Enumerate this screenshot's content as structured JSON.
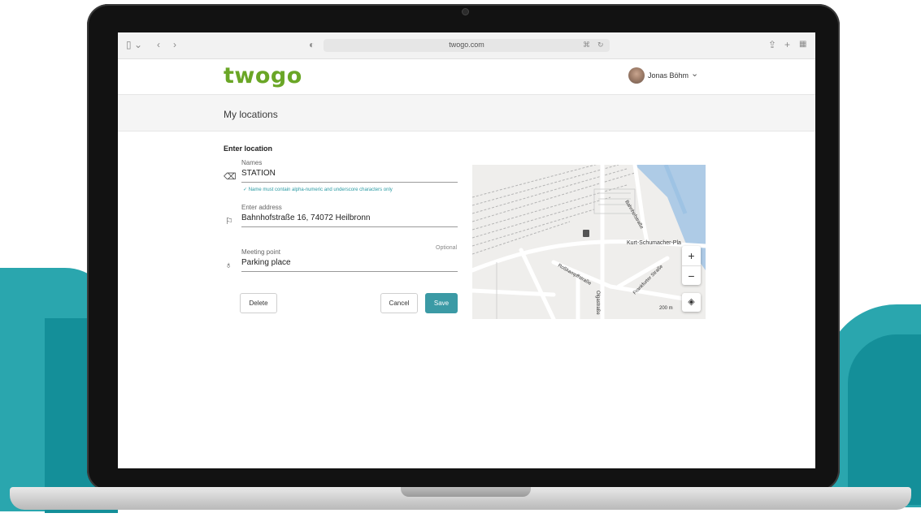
{
  "browser": {
    "url": "twogo.com"
  },
  "app": {
    "logo": "twogo",
    "user_name": "Jonas Böhm",
    "page_title": "My locations"
  },
  "form": {
    "section_title": "Enter location",
    "name": {
      "label": "Names",
      "value": "STATION",
      "hint": "Name must contain alpha-numeric and underscore characters only"
    },
    "address": {
      "label": "Enter address",
      "value": "Bahnhofstraße 16, 74072 Heilbronn"
    },
    "meeting_point": {
      "label": "Meeting point",
      "value": "Parking place",
      "optional_label": "Optional"
    },
    "buttons": {
      "delete": "Delete",
      "cancel": "Cancel",
      "save": "Save"
    }
  },
  "map": {
    "street_labels": [
      "Kurt-Schumacher-Pla",
      "Bahnhofstraße",
      "Roßkampffstraße",
      "Frankfurter Straße",
      "Olgastraße"
    ],
    "zoom_in": "+",
    "zoom_out": "−",
    "scale": "200 m"
  },
  "colors": {
    "accent": "#3b9aa5",
    "logo": "#6aa626",
    "background_teal": "#2aa6ae"
  }
}
